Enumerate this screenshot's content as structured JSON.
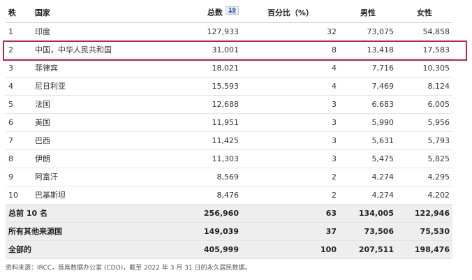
{
  "table": {
    "headers": {
      "rank": "秩",
      "country": "国家",
      "total": "总数",
      "total_footnote": "19",
      "percent": "百分比（%）",
      "male": "男性",
      "female": "女性"
    },
    "rows": [
      {
        "rank": "1",
        "country": "印度",
        "total": "127,933",
        "percent": "32",
        "male": "73,075",
        "female": "54,858"
      },
      {
        "rank": "2",
        "country": "中国，中华人民共和国",
        "total": "31,001",
        "percent": "8",
        "male": "13,418",
        "female": "17,583"
      },
      {
        "rank": "3",
        "country": "菲律宾",
        "total": "18,021",
        "percent": "4",
        "male": "7,716",
        "female": "10,305"
      },
      {
        "rank": "4",
        "country": "尼日利亚",
        "total": "15,593",
        "percent": "4",
        "male": "7,469",
        "female": "8,124"
      },
      {
        "rank": "5",
        "country": "法国",
        "total": "12,688",
        "percent": "3",
        "male": "6,683",
        "female": "6,005"
      },
      {
        "rank": "6",
        "country": "美国",
        "total": "11,951",
        "percent": "3",
        "male": "5,990",
        "female": "5,956"
      },
      {
        "rank": "7",
        "country": "巴西",
        "total": "11,425",
        "percent": "3",
        "male": "5,631",
        "female": "5,793"
      },
      {
        "rank": "8",
        "country": "伊朗",
        "total": "11,303",
        "percent": "3",
        "male": "5,475",
        "female": "5,825"
      },
      {
        "rank": "9",
        "country": "阿富汗",
        "total": "8,569",
        "percent": "2",
        "male": "4,274",
        "female": "4,295"
      },
      {
        "rank": "10",
        "country": "巴基斯坦",
        "total": "8,476",
        "percent": "2",
        "male": "4,274",
        "female": "4,202"
      }
    ],
    "summary": [
      {
        "label": "总前 10 名",
        "total": "256,960",
        "percent": "63",
        "male": "134,005",
        "female": "122,946"
      },
      {
        "label": "所有其他来源国",
        "total": "149,039",
        "percent": "37",
        "male": "73,506",
        "female": "75,530"
      },
      {
        "label": "全部的",
        "total": "405,999",
        "percent": "100",
        "male": "207,511",
        "female": "198,476"
      }
    ]
  },
  "highlight_color": "#c41e4a",
  "source_note": "资料来源：IRCC，首席数据办公室 (CDO)，截至 2022 年 3 月 31 日的永久居民数据。"
}
